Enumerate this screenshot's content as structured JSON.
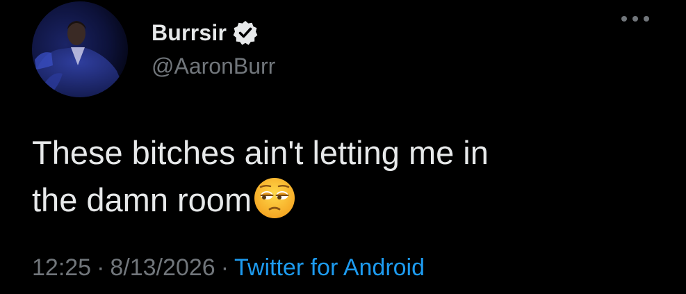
{
  "tweet": {
    "display_name": "Burrsir",
    "handle": "@AaronBurr",
    "text_line1": "These bitches ain't letting me in",
    "text_line2": "the damn room",
    "emoji": "unamused-face-icon",
    "time": "12:25",
    "separator": "·",
    "date": "8/13/2026",
    "source": "Twitter for Android",
    "verified_icon": "verified-badge-icon",
    "more_icon": "more-options-icon"
  },
  "colors": {
    "background": "#000000",
    "primary_text": "#e7e9ea",
    "secondary_text": "#71767b",
    "link": "#1d9bf0"
  }
}
